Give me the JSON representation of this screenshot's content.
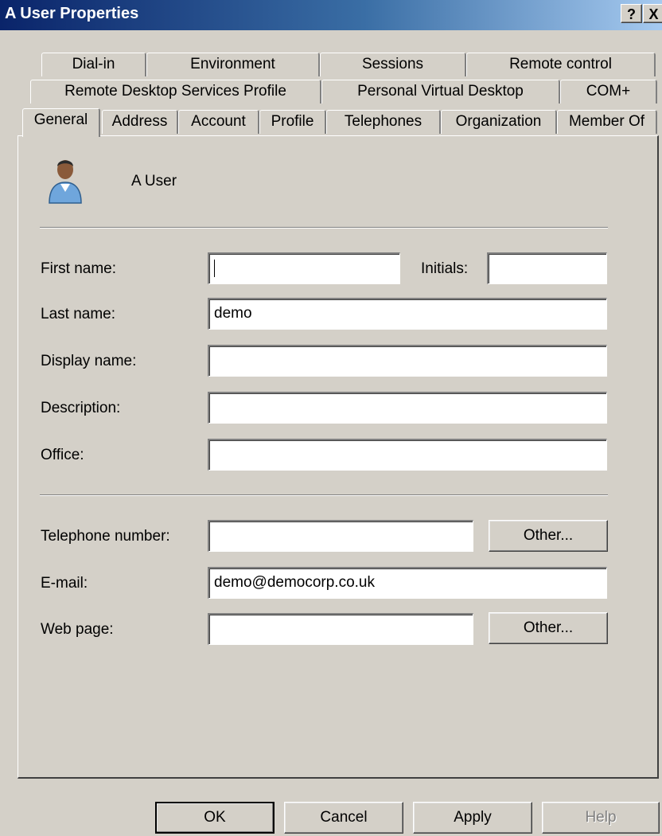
{
  "window": {
    "title": "A User Properties"
  },
  "titlebar": {
    "help": "?",
    "close": "X"
  },
  "tabs": {
    "row1": [
      "Dial-in",
      "Environment",
      "Sessions",
      "Remote control"
    ],
    "row2": [
      "Remote Desktop Services Profile",
      "Personal Virtual Desktop",
      "COM+"
    ],
    "row3": [
      "General",
      "Address",
      "Account",
      "Profile",
      "Telephones",
      "Organization",
      "Member Of"
    ],
    "active": "General"
  },
  "general": {
    "user_name": "A User",
    "first_name_label": "First name:",
    "first_name": "",
    "initials_label": "Initials:",
    "initials": "",
    "last_name_label": "Last name:",
    "last_name": "demo",
    "display_name_label": "Display name:",
    "display_name": "",
    "description_label": "Description:",
    "description": "",
    "office_label": "Office:",
    "office": "",
    "telephone_label": "Telephone number:",
    "telephone": "",
    "email_label": "E-mail:",
    "email": "demo@democorp.co.uk",
    "webpage_label": "Web page:",
    "webpage": "",
    "other_label": "Other..."
  },
  "buttons": {
    "ok": "OK",
    "cancel": "Cancel",
    "apply": "Apply",
    "help": "Help"
  }
}
